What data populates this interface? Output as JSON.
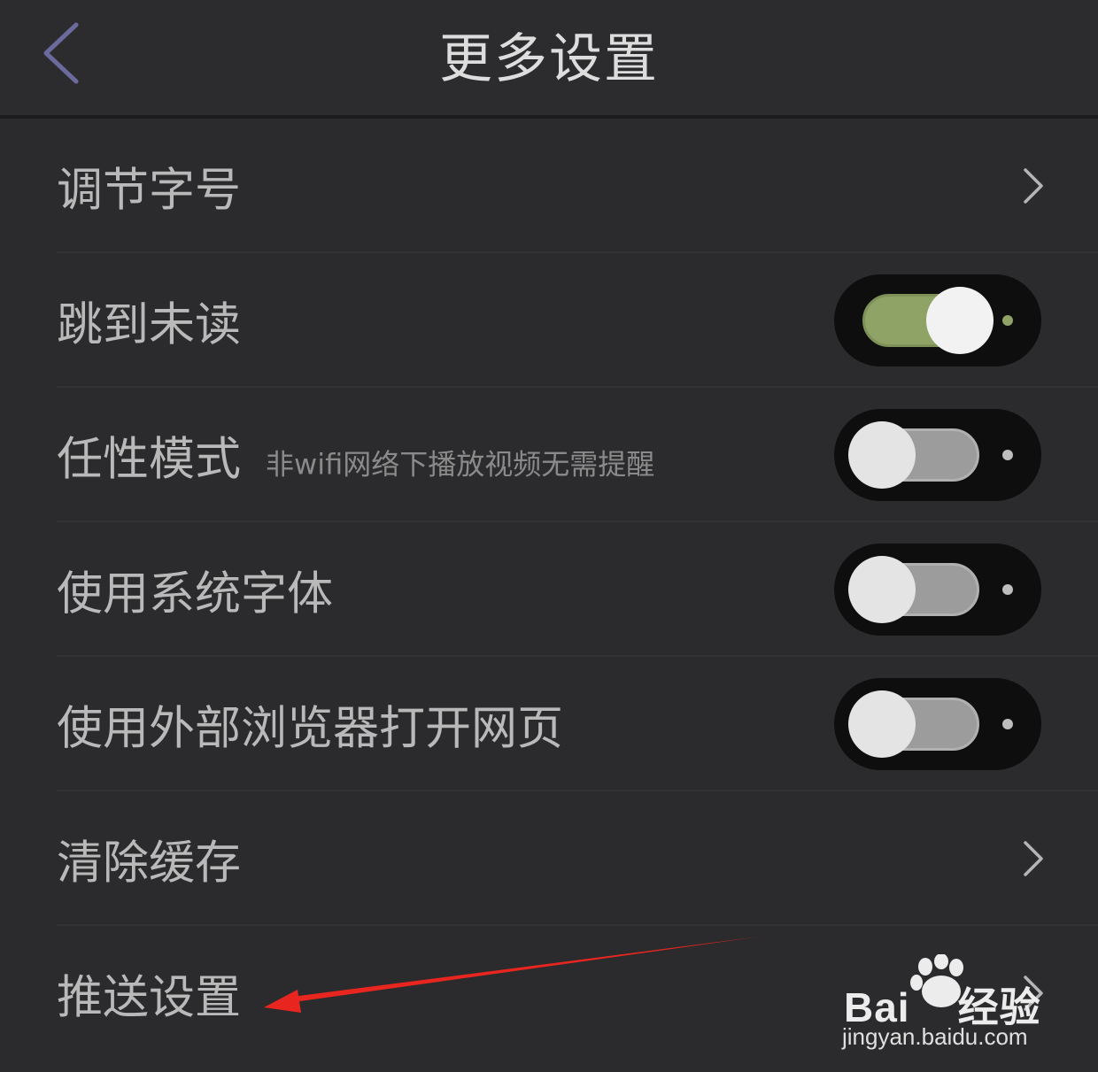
{
  "header": {
    "title": "更多设置",
    "back_icon": "chevron-left-icon"
  },
  "settings": [
    {
      "label": "调节字号",
      "control": "chevron"
    },
    {
      "label": "跳到未读",
      "control": "switch",
      "on": true
    },
    {
      "label": "任性模式",
      "sublabel": "非wifi网络下播放视频无需提醒",
      "control": "switch",
      "on": false
    },
    {
      "label": "使用系统字体",
      "control": "switch",
      "on": false
    },
    {
      "label": "使用外部浏览器打开网页",
      "control": "switch",
      "on": false
    },
    {
      "label": "清除缓存",
      "control": "chevron"
    },
    {
      "label": "推送设置",
      "control": "chevron"
    }
  ],
  "colors": {
    "background": "#2b2b2d",
    "switch_on": "#8fa366",
    "annotation_arrow": "#e8261f",
    "back_icon": "#6b6a9c"
  },
  "watermark": {
    "brand": "Bai",
    "brand_suffix": "经验",
    "url": "jingyan.baidu.com"
  }
}
